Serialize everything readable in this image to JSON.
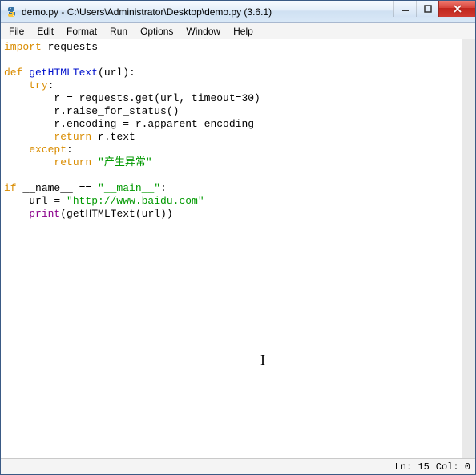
{
  "window": {
    "title": "demo.py - C:\\Users\\Administrator\\Desktop\\demo.py (3.6.1)"
  },
  "menu": {
    "file": "File",
    "edit": "Edit",
    "format": "Format",
    "run": "Run",
    "options": "Options",
    "window": "Window",
    "help": "Help"
  },
  "code": {
    "l1_kw": "import",
    "l1_rest": " requests",
    "l3_kw": "def",
    "l3_name": " getHTMLText",
    "l3_rest": "(url):",
    "l4_kw": "try",
    "l4_rest": ":",
    "l5": "        r = requests.get(url, timeout=30)",
    "l6": "        r.raise_for_status()",
    "l7": "        r.encoding = r.apparent_encoding",
    "l8_kw": "return",
    "l8_rest": " r.text",
    "l9_kw": "except",
    "l9_rest": ":",
    "l10_kw": "return",
    "l10_sp": " ",
    "l10_str": "\"产生异常\"",
    "l12_kw": "if",
    "l12_sp1": " __name__ == ",
    "l12_str": "\"__main__\"",
    "l12_rest": ":",
    "l13_a": "    url = ",
    "l13_str": "\"http://www.baidu.com\"",
    "l14_pre": "    ",
    "l14_print": "print",
    "l14_rest": "(getHTMLText(url))"
  },
  "status": {
    "ln": "Ln: 15",
    "col": "Col: 0"
  }
}
